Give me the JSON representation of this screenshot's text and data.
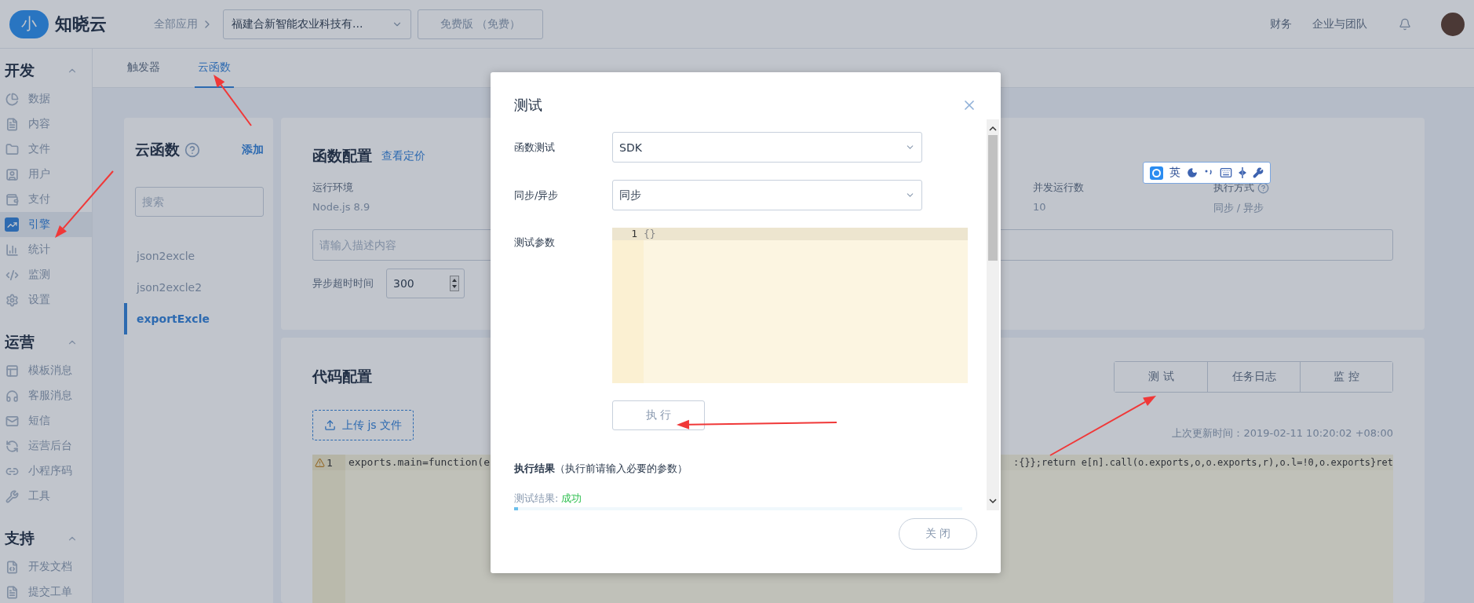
{
  "top_bar": {
    "logo_mark": "小",
    "brand": "知晓云",
    "breadcrumb": "全部应用",
    "app_select": "福建合新智能农业科技有...",
    "plan_button": "免费版 （免费）",
    "links": [
      "财务",
      "企业与团队"
    ]
  },
  "sidebar": {
    "sections": [
      {
        "title": "开发",
        "expanded": true,
        "items": [
          {
            "label": "数据",
            "selected": false
          },
          {
            "label": "内容",
            "selected": false
          },
          {
            "label": "文件",
            "selected": false
          },
          {
            "label": "用户",
            "selected": false
          },
          {
            "label": "支付",
            "selected": false
          },
          {
            "label": "引擎",
            "selected": true
          },
          {
            "label": "统计",
            "selected": false
          },
          {
            "label": "监测",
            "selected": false
          },
          {
            "label": "设置",
            "selected": false
          }
        ]
      },
      {
        "title": "运营",
        "expanded": true,
        "items": [
          {
            "label": "模板消息",
            "selected": false
          },
          {
            "label": "客服消息",
            "selected": false
          },
          {
            "label": "短信",
            "selected": false
          },
          {
            "label": "运营后台",
            "selected": false
          },
          {
            "label": "小程序码",
            "selected": false
          },
          {
            "label": "工具",
            "selected": false
          }
        ]
      },
      {
        "title": "支持",
        "expanded": true,
        "items": [
          {
            "label": "开发文档",
            "selected": false
          },
          {
            "label": "提交工单",
            "selected": false
          }
        ]
      }
    ]
  },
  "tabs": [
    {
      "label": "触发器",
      "selected": false
    },
    {
      "label": "云函数",
      "selected": true
    }
  ],
  "functions_panel": {
    "title": "云函数",
    "add_link": "添加",
    "search": {
      "placeholder": "搜索"
    },
    "items": [
      {
        "label": "json2excle",
        "selected": false
      },
      {
        "label": "json2excle2",
        "selected": false
      },
      {
        "label": "exportExcle",
        "selected": true
      }
    ]
  },
  "config_card": {
    "title": "函数配置",
    "pricing_link": "查看定价",
    "fields": [
      {
        "label": "运行环境",
        "value": "Node.js 8.9",
        "help": false
      },
      {
        "label": "并发运行数",
        "value": "10",
        "help": false
      },
      {
        "label": "执行方式",
        "value": "同步 / 异步",
        "help": true
      }
    ],
    "description": {
      "placeholder": "请输入描述内容"
    },
    "timeout": {
      "label": "异步超时时间",
      "value": "300"
    }
  },
  "code_card": {
    "title": "代码配置",
    "actions": [
      "测 试",
      "任务日志",
      "监 控"
    ],
    "upload_button": "上传 js 文件",
    "updated": "上次更新时间：2019-02-11 10:20:02 +08:00",
    "editor": {
      "line_number": "1",
      "warning": true,
      "line_start": "exports.main=function(e",
      "line_end": ":{}};return e[n].call(o.exports,o,o.exports,r),o.l=!0,o.exports}ret"
    }
  },
  "modal": {
    "title": "测试",
    "fields": [
      {
        "label": "函数测试",
        "value": "SDK"
      },
      {
        "label": "同步/异步",
        "value": "同步"
      }
    ],
    "params": {
      "label": "测试参数",
      "line_number": "1",
      "code": "{}"
    },
    "run_button": "执 行",
    "result_heading": "执行结果",
    "result_hint": "（执行前请输入必要的参数）",
    "result_label": "测试结果:",
    "result_value": "成功",
    "close_button": "关 闭"
  },
  "ime_bar": {
    "mode": "英"
  }
}
